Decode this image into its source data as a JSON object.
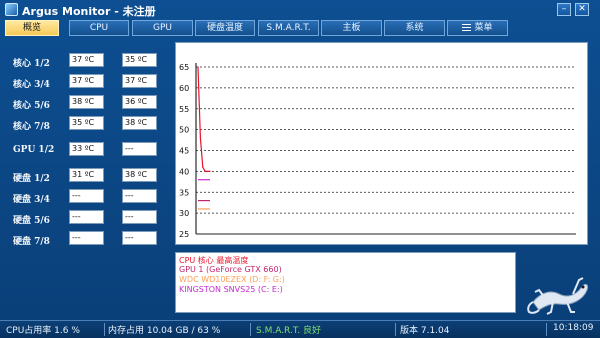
{
  "window": {
    "title": "Argus Monitor - 未注册"
  },
  "tabs": [
    "概览",
    "CPU",
    "GPU",
    "硬盘温度",
    "S.M.A.R.T.",
    "主板",
    "系统",
    "菜单"
  ],
  "active_tab": 0,
  "sensors": [
    {
      "label": "核心 1/2",
      "v1": "37 ºC",
      "v2": "35 ºC"
    },
    {
      "label": "核心 3/4",
      "v1": "37 ºC",
      "v2": "37 ºC"
    },
    {
      "label": "核心 5/6",
      "v1": "38 ºC",
      "v2": "36 ºC"
    },
    {
      "label": "核心 7/8",
      "v1": "35 ºC",
      "v2": "38 ºC"
    },
    {
      "label": "GPU 1/2",
      "v1": "33 ºC",
      "v2": "---"
    },
    {
      "label": "硬盘 1/2",
      "v1": "31 ºC",
      "v2": "38 ºC"
    },
    {
      "label": "硬盘 3/4",
      "v1": "---",
      "v2": "---"
    },
    {
      "label": "硬盘 5/6",
      "v1": "---",
      "v2": "---"
    },
    {
      "label": "硬盘 7/8",
      "v1": "---",
      "v2": "---"
    }
  ],
  "chart_data": {
    "type": "line",
    "ylim": [
      25,
      65
    ],
    "y_ticks": [
      65,
      60,
      55,
      50,
      45,
      40,
      35,
      30,
      25
    ],
    "grid": true,
    "series": [
      {
        "name": "CPU 核心 最高温度",
        "color": "#e8132b",
        "x": [
          0,
          1,
          2,
          3,
          4,
          5
        ],
        "values": [
          65,
          48,
          41,
          40,
          40,
          40
        ]
      }
    ],
    "legend": [
      {
        "text": "CPU 核心 最高温度",
        "color": "#e8132b"
      },
      {
        "text": "GPU 1 (GeForce GTX 660)",
        "color": "#c0276f"
      },
      {
        "text": "WDC WD10EZEX (D: F: G:)",
        "color": "#ff9f57"
      },
      {
        "text": "KINGSTON SNVS25 (C: E:)",
        "color": "#c52ad1"
      }
    ],
    "markers": [
      {
        "value": 38,
        "color": "#c52ad1"
      },
      {
        "value": 33,
        "color": "#c0276f"
      },
      {
        "value": 31,
        "color": "#ff9f57"
      }
    ]
  },
  "status": {
    "cpu_usage": "CPU占用率 1.6 %",
    "memory": "内存占用 10.04 GB / 63 %",
    "smart": "S.M.A.R.T. 良好",
    "version": "版本 7.1.04",
    "time": "10:18:09"
  }
}
